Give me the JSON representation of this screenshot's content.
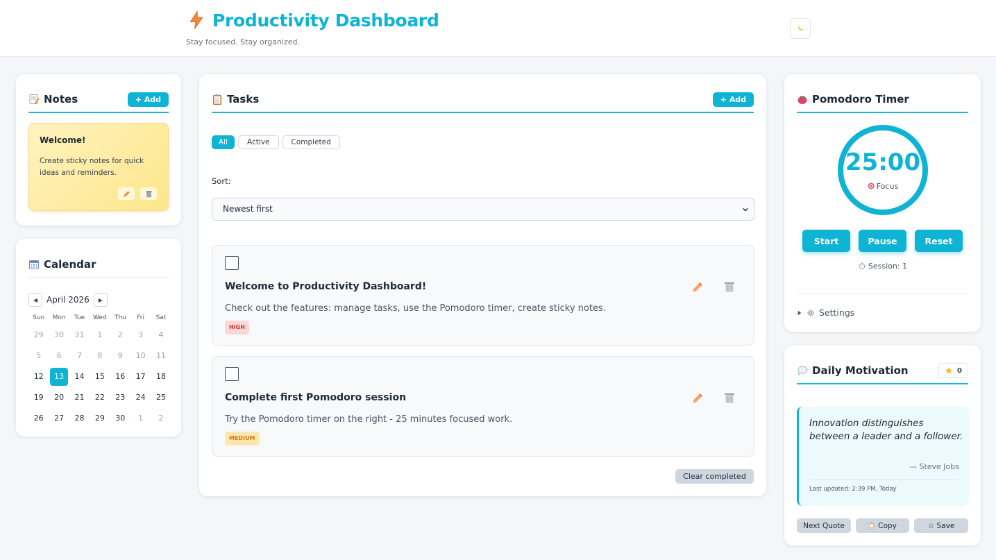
{
  "header": {
    "title": "Productivity Dashboard",
    "subtitle": "Stay focused. Stay organized.",
    "theme_toggle_icon": "moon-icon"
  },
  "notes": {
    "title": "Notes",
    "add_label": "+ Add",
    "items": [
      {
        "title": "Welcome!",
        "body": "Create sticky notes for quick ideas and reminders."
      }
    ]
  },
  "calendar": {
    "title": "Calendar",
    "month_label": "April 2026",
    "prev_label": "◀",
    "next_label": "▶",
    "weekdays": [
      "Sun",
      "Mon",
      "Tue",
      "Wed",
      "Thu",
      "Fri",
      "Sat"
    ],
    "weeks": [
      [
        "29",
        "30",
        "31",
        "1",
        "2",
        "3",
        "4"
      ],
      [
        "5",
        "6",
        "7",
        "8",
        "9",
        "10",
        "11"
      ],
      [
        "12",
        "13",
        "14",
        "15",
        "16",
        "17",
        "18"
      ],
      [
        "19",
        "20",
        "21",
        "22",
        "23",
        "24",
        "25"
      ],
      [
        "26",
        "27",
        "28",
        "29",
        "30",
        "1",
        "2"
      ]
    ],
    "today": "13"
  },
  "tasks": {
    "title": "Tasks",
    "add_label": "+ Add",
    "filters": [
      "All",
      "Active",
      "Completed"
    ],
    "active_filter": "All",
    "sort_label": "Sort:",
    "sort_value": "Newest first",
    "items": [
      {
        "title": "Welcome to Productivity Dashboard!",
        "description": "Check out the features: manage tasks, use the Pomodoro timer, create sticky notes.",
        "priority": "HIGH"
      },
      {
        "title": "Complete first Pomodoro session",
        "description": "Try the Pomodoro timer on the right - 25 minutes focused work.",
        "priority": "MEDIUM"
      }
    ],
    "clear_label": "Clear completed"
  },
  "pomodoro": {
    "title": "Pomodoro Timer",
    "time": "25:00",
    "mode": "Focus",
    "start_label": "Start",
    "pause_label": "Pause",
    "reset_label": "Reset",
    "session_label": "Session: 1",
    "settings_label": "Settings"
  },
  "motivation": {
    "title": "Daily Motivation",
    "star_count": "0",
    "quote": "Innovation distinguishes between a leader and a follower.",
    "author": "— Steve Jobs",
    "updated": "Last updated: 2:39 PM, Today",
    "next_label": "Next Quote",
    "copy_label": "Copy",
    "save_label": "☆ Save"
  },
  "colors": {
    "accent": "#0fb3d4",
    "background": "#f4f6f8",
    "note_yellow": "#fde68a",
    "high_badge": "#fcd7d7",
    "medium_badge": "#fde7b0"
  }
}
